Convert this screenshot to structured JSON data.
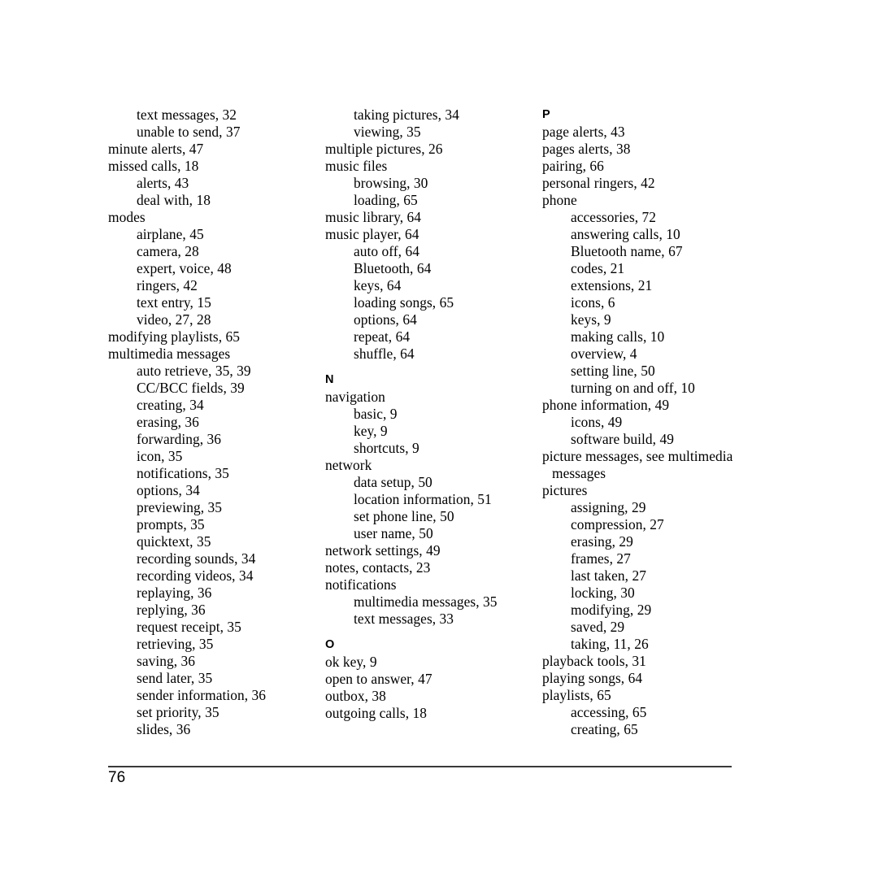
{
  "page": {
    "number": "76",
    "type": "index"
  },
  "columns": [
    {
      "name": "column-1",
      "entries": [
        {
          "text": "text messages, 32",
          "level": 2
        },
        {
          "text": "unable to send, 37",
          "level": 2
        },
        {
          "text": "minute alerts, 47",
          "level": 1
        },
        {
          "text": "missed calls, 18",
          "level": 1
        },
        {
          "text": "alerts, 43",
          "level": 2
        },
        {
          "text": "deal with, 18",
          "level": 2
        },
        {
          "text": "modes",
          "level": 1
        },
        {
          "text": "airplane, 45",
          "level": 2
        },
        {
          "text": "camera, 28",
          "level": 2
        },
        {
          "text": "expert, voice, 48",
          "level": 2
        },
        {
          "text": "ringers, 42",
          "level": 2
        },
        {
          "text": "text entry, 15",
          "level": 2
        },
        {
          "text": "video, 27, 28",
          "level": 2
        },
        {
          "text": "modifying playlists, 65",
          "level": 1
        },
        {
          "text": "multimedia messages",
          "level": 1
        },
        {
          "text": "auto retrieve, 35, 39",
          "level": 2
        },
        {
          "text": "CC/BCC fields, 39",
          "level": 2
        },
        {
          "text": "creating, 34",
          "level": 2
        },
        {
          "text": "erasing, 36",
          "level": 2
        },
        {
          "text": "forwarding, 36",
          "level": 2
        },
        {
          "text": "icon, 35",
          "level": 2
        },
        {
          "text": "notifications, 35",
          "level": 2
        },
        {
          "text": "options, 34",
          "level": 2
        },
        {
          "text": "previewing, 35",
          "level": 2
        },
        {
          "text": "prompts, 35",
          "level": 2
        },
        {
          "text": "quicktext, 35",
          "level": 2
        },
        {
          "text": "recording sounds, 34",
          "level": 2
        },
        {
          "text": "recording videos, 34",
          "level": 2
        },
        {
          "text": "replaying, 36",
          "level": 2
        },
        {
          "text": "replying, 36",
          "level": 2
        },
        {
          "text": "request receipt, 35",
          "level": 2
        },
        {
          "text": "retrieving, 35",
          "level": 2
        },
        {
          "text": "saving, 36",
          "level": 2
        },
        {
          "text": "send later, 35",
          "level": 2
        },
        {
          "text": "sender information, 36",
          "level": 2
        },
        {
          "text": "set priority, 35",
          "level": 2
        },
        {
          "text": "slides, 36",
          "level": 2
        }
      ]
    },
    {
      "name": "column-2",
      "entries": [
        {
          "text": "taking pictures, 34",
          "level": 2
        },
        {
          "text": "viewing, 35",
          "level": 2
        },
        {
          "text": "multiple pictures, 26",
          "level": 1
        },
        {
          "text": "music files",
          "level": 1
        },
        {
          "text": "browsing, 30",
          "level": 2
        },
        {
          "text": "loading, 65",
          "level": 2
        },
        {
          "text": "music library, 64",
          "level": 1
        },
        {
          "text": "music player, 64",
          "level": 1
        },
        {
          "text": "auto off, 64",
          "level": 2
        },
        {
          "text": "Bluetooth, 64",
          "level": 2
        },
        {
          "text": "keys, 64",
          "level": 2
        },
        {
          "text": "loading songs, 65",
          "level": 2
        },
        {
          "text": "options, 64",
          "level": 2
        },
        {
          "text": "repeat, 64",
          "level": 2
        },
        {
          "text": "shuffle, 64",
          "level": 2
        },
        {
          "text": "N",
          "level": 0
        },
        {
          "text": "navigation",
          "level": 1
        },
        {
          "text": "basic, 9",
          "level": 2
        },
        {
          "text": "key, 9",
          "level": 2
        },
        {
          "text": "shortcuts, 9",
          "level": 2
        },
        {
          "text": "network",
          "level": 1
        },
        {
          "text": "data setup, 50",
          "level": 2
        },
        {
          "text": "location information, 51",
          "level": 2
        },
        {
          "text": "set phone line, 50",
          "level": 2
        },
        {
          "text": "user name, 50",
          "level": 2
        },
        {
          "text": "network settings, 49",
          "level": 1
        },
        {
          "text": "notes, contacts, 23",
          "level": 1
        },
        {
          "text": "notifications",
          "level": 1
        },
        {
          "text": "multimedia messages, 35",
          "level": 2
        },
        {
          "text": "text messages, 33",
          "level": 2
        },
        {
          "text": "O",
          "level": 0
        },
        {
          "text": "ok key, 9",
          "level": 1
        },
        {
          "text": "open to answer, 47",
          "level": 1
        },
        {
          "text": "outbox, 38",
          "level": 1
        },
        {
          "text": "outgoing calls, 18",
          "level": 1
        }
      ]
    },
    {
      "name": "column-3",
      "entries": [
        {
          "text": "P",
          "level": 0
        },
        {
          "text": "page alerts, 43",
          "level": 1
        },
        {
          "text": "pages alerts, 38",
          "level": 1
        },
        {
          "text": "pairing, 66",
          "level": 1
        },
        {
          "text": "personal ringers, 42",
          "level": 1
        },
        {
          "text": "phone",
          "level": 1
        },
        {
          "text": "accessories, 72",
          "level": 2
        },
        {
          "text": "answering calls, 10",
          "level": 2
        },
        {
          "text": "Bluetooth name, 67",
          "level": 2
        },
        {
          "text": "codes, 21",
          "level": 2
        },
        {
          "text": "extensions, 21",
          "level": 2
        },
        {
          "text": "icons, 6",
          "level": 2
        },
        {
          "text": "keys, 9",
          "level": 2
        },
        {
          "text": "making calls, 10",
          "level": 2
        },
        {
          "text": "overview, 4",
          "level": 2
        },
        {
          "text": "setting line, 50",
          "level": 2
        },
        {
          "text": "turning on and off, 10",
          "level": 2
        },
        {
          "text": "phone information, 49",
          "level": 1
        },
        {
          "text": "icons, 49",
          "level": 2
        },
        {
          "text": "software build, 49",
          "level": 2
        },
        {
          "text": "picture messages, see multimedia messages",
          "level": 1,
          "wrap": true
        },
        {
          "text": "pictures",
          "level": 1
        },
        {
          "text": "assigning, 29",
          "level": 2
        },
        {
          "text": "compression, 27",
          "level": 2
        },
        {
          "text": "erasing, 29",
          "level": 2
        },
        {
          "text": "frames, 27",
          "level": 2
        },
        {
          "text": "last taken, 27",
          "level": 2
        },
        {
          "text": "locking, 30",
          "level": 2
        },
        {
          "text": "modifying, 29",
          "level": 2
        },
        {
          "text": "saved, 29",
          "level": 2
        },
        {
          "text": "taking, 11, 26",
          "level": 2
        },
        {
          "text": "playback tools, 31",
          "level": 1
        },
        {
          "text": "playing songs, 64",
          "level": 1
        },
        {
          "text": "playlists, 65",
          "level": 1
        },
        {
          "text": "accessing, 65",
          "level": 2
        },
        {
          "text": "creating, 65",
          "level": 2
        }
      ]
    }
  ]
}
